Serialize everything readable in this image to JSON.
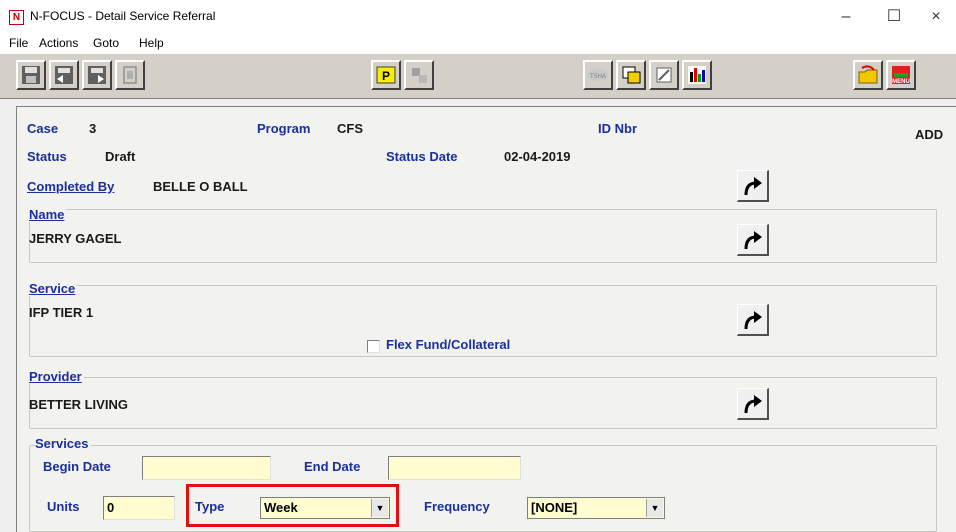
{
  "window": {
    "title": "N-FOCUS - Detail Service Referral",
    "app_icon_letter": "N",
    "minimize": "–",
    "maximize": "☐",
    "close": "×"
  },
  "menu": [
    "File",
    "Actions",
    "Goto",
    "Help"
  ],
  "toolbar": {
    "p_button": "P",
    "tsha_label": "TSHA",
    "menu_label": "MENU"
  },
  "header": {
    "case_label": "Case",
    "case_value": "3",
    "program_label": "Program",
    "program_value": "CFS",
    "id_label": "ID Nbr",
    "id_value": "",
    "mode": "ADD",
    "status_label": "Status",
    "status_value": "Draft",
    "status_date_label": "Status Date",
    "status_date_value": "02-04-2019",
    "completed_by_label": "Completed By",
    "completed_by_value": "BELLE O BALL"
  },
  "name_group": {
    "label": "Name",
    "value": "JERRY GAGEL"
  },
  "service_group": {
    "label": "Service",
    "value": "IFP TIER 1",
    "flex_label": "Flex Fund/Collateral",
    "flex_checked": false
  },
  "provider_group": {
    "label": "Provider",
    "value": "BETTER LIVING"
  },
  "services": {
    "label": "Services",
    "begin_date_label": "Begin Date",
    "begin_date_value": "",
    "end_date_label": "End Date",
    "end_date_value": "",
    "units_label": "Units",
    "units_value": "0",
    "type_label": "Type",
    "type_value": "Week",
    "frequency_label": "Frequency",
    "frequency_value": "[NONE]"
  },
  "colors": {
    "label_blue": "#1a2fa0",
    "input_yellow": "#fffcd0",
    "highlight_red": "#e01010"
  }
}
